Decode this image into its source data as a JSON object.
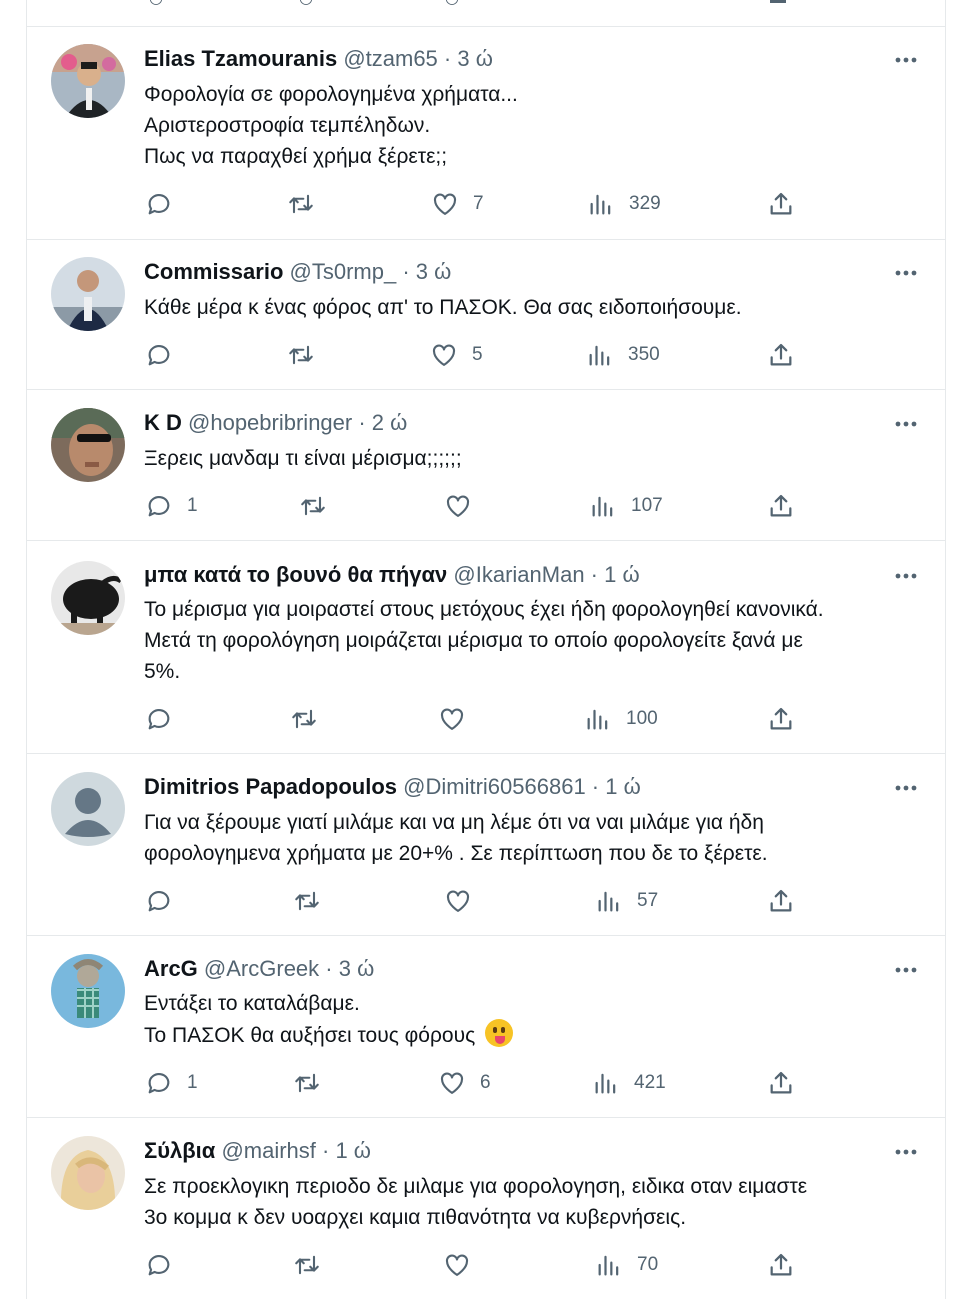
{
  "tweets": [
    {
      "name": "Elias Tzamouranis",
      "handle": "@tzam65",
      "time": " · 3 ώ",
      "lines": [
        "Φορολογία σε φορολογημένα χρήματα...",
        "Αριστεροστροφία τεμπέληδων.",
        "Πως να παραχθεί χρήμα ξέρετε;;"
      ],
      "replies": "",
      "retweets": "",
      "likes": "7",
      "views": "329"
    },
    {
      "name": "Commissario",
      "handle": "@Ts0rmp_",
      "time": " · 3 ώ",
      "lines": [
        "Κάθε μέρα κ ένας φόρος απ' το ΠΑΣΟΚ. Θα σας ειδοποιήσουμε."
      ],
      "replies": "",
      "retweets": "",
      "likes": "5",
      "views": "350"
    },
    {
      "name": "K D",
      "handle": "@hopebribringer",
      "time": " · 2 ώ",
      "lines": [
        "Ξερεις μανδαμ τι είναι μέρισμα;;;;;;"
      ],
      "replies": "1",
      "retweets": "",
      "likes": "",
      "views": "107"
    },
    {
      "name": "μπα κατά το βουνό θα πήγαν",
      "handle": "@IkarianMan",
      "time": " · 1 ώ",
      "lines": [
        "Το μέρισμα για μοιραστεί στους μετόχους έχει ήδη φορολογηθεί κανονικά.",
        "Μετά τη φορολόγηση μοιράζεται μέρισμα το οποίο φορολογείτε ξανά με",
        "5%."
      ],
      "replies": "",
      "retweets": "",
      "likes": "",
      "views": "100"
    },
    {
      "name": "Dimitrios Papadopoulos",
      "handle": "@Dimitri60566861",
      "time": " · 1 ώ",
      "lines": [
        "Για να ξέρουμε γιατί μιλάμε και να μη λέμε ότι να ναι μιλάμε για ήδη",
        "φορολογημενα χρήματα με 20+% . Σε περίπτωση που δε το ξέρετε."
      ],
      "replies": "",
      "retweets": "",
      "likes": "",
      "views": "57"
    },
    {
      "name": "ArcG",
      "handle": "@ArcGreek",
      "time": " · 3 ώ",
      "lines": [
        "Εντάξει το καταλάβαμε.",
        "Το ΠΑΣΟΚ θα αυξήσει τους φόρους"
      ],
      "emoji": "face-with-tongue-emoji",
      "replies": "1",
      "retweets": "",
      "likes": "6",
      "views": "421"
    },
    {
      "name": "Σύλβια",
      "handle": "@mairhsf",
      "time": " · 1 ώ",
      "lines": [
        "Σε προεκλογικη περιοδο δε μιλαμε για φορολογηση, ειδικα οταν ειμαστε",
        "3ο κομμα κ δεν υοαρχει καμια πιθανότητα να κυβερνήσεις."
      ],
      "replies": "",
      "retweets": "",
      "likes": "",
      "views": "70"
    }
  ],
  "icons": {
    "reply": "reply-icon",
    "retweet": "retweet-icon",
    "like": "heart-icon",
    "views": "views-icon",
    "share": "share-icon",
    "more": "more-icon"
  },
  "colors": {
    "text": "#0f1419",
    "secondary": "#536471",
    "border": "#e6e9eb"
  }
}
